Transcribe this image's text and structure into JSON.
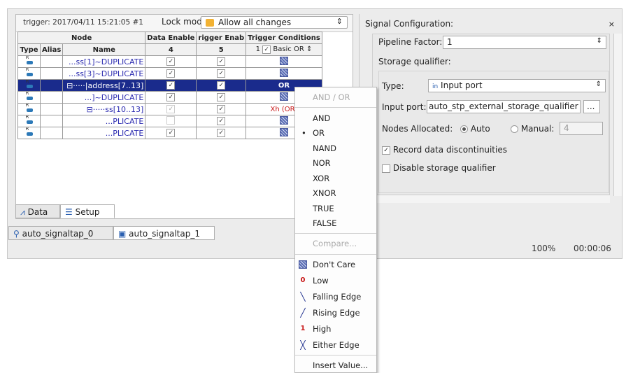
{
  "header": {
    "trigger_info": "trigger: 2017/04/11 15:21:05  #1",
    "lock_mode_label": "Lock mode:",
    "lock_mode_value": "Allow all changes"
  },
  "table": {
    "group_node": "Node",
    "col_type": "Type",
    "col_alias": "Alias",
    "col_name": "Name",
    "col_data_enable": "Data Enable",
    "col_trigger_enable": "rigger Enab",
    "col_trigger_cond": "Trigger Conditions",
    "sub_data_enable": "4",
    "sub_trigger_enable": "5",
    "sub_trigger_cond_num": "1",
    "sub_trigger_cond_mode": "Basic OR",
    "rows": [
      {
        "name": "...ss[1]~DUPLICATE",
        "cond": ""
      },
      {
        "name": "...ss[3]~DUPLICATE",
        "cond": ""
      },
      {
        "name": "⊟·····|address[7..13]",
        "cond": "OR"
      },
      {
        "name": "...]~DUPLICATE",
        "cond": ""
      },
      {
        "name": "⊟·····ss[10..13]",
        "cond": "Xh (OR)"
      },
      {
        "name": "...PLICATE",
        "cond": ""
      },
      {
        "name": "...PLICATE",
        "cond": ""
      }
    ]
  },
  "tabs": {
    "data": "Data",
    "setup": "Setup"
  },
  "instances": {
    "tab0": "auto_signaltap_0",
    "tab1": "auto_signaltap_1"
  },
  "status": {
    "zoom": "100%",
    "time": "00:00:06"
  },
  "config": {
    "title": "Signal Configuration:",
    "close": "×",
    "pipeline_label": "Pipeline Factor:",
    "pipeline_value": "1",
    "storage_label": "Storage qualifier:",
    "type_label": "Type:",
    "type_value": "Input port",
    "input_port_label": "Input port:",
    "input_port_value": "auto_stp_external_storage_qualifier",
    "browse": "...",
    "nodes_alloc_label": "Nodes Allocated:",
    "auto_label": "Auto",
    "manual_label": "Manual:",
    "manual_value": "4",
    "record_label": "Record data discontinuities",
    "disable_label": "Disable storage qualifier"
  },
  "menu": {
    "andor_header": "AND / OR",
    "items": [
      "AND",
      "OR",
      "NAND",
      "NOR",
      "XOR",
      "XNOR",
      "TRUE",
      "FALSE"
    ],
    "selected": "OR",
    "compare": "Compare...",
    "conditions": [
      "Don't Care",
      "Low",
      "Falling Edge",
      "Rising Edge",
      "High",
      "Either Edge"
    ],
    "insert_value": "Insert Value..."
  }
}
